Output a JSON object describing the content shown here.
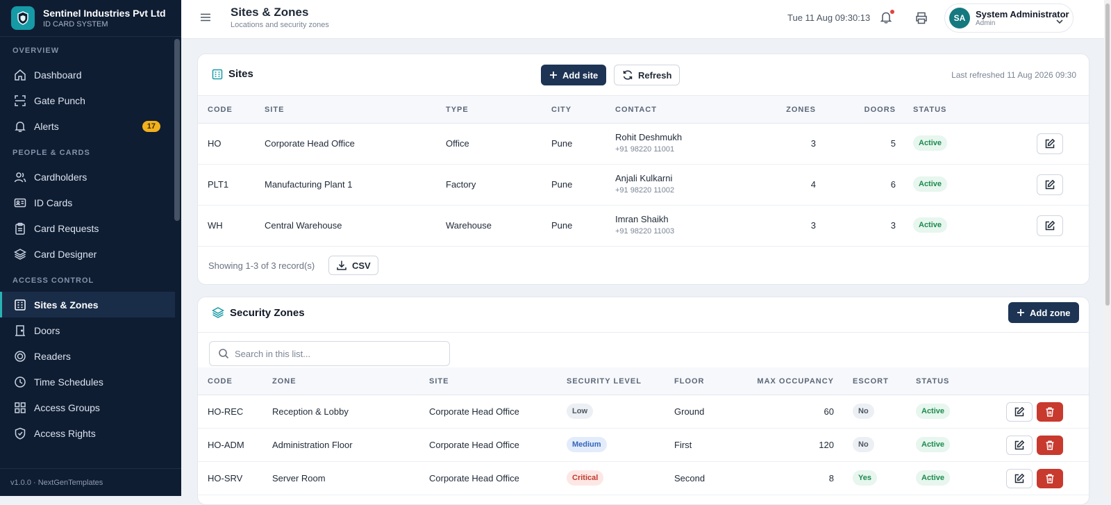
{
  "brand": {
    "name": "Sentinel Industries Pvt Ltd",
    "subtitle": "ID CARD SYSTEM"
  },
  "sidebar": {
    "sections": [
      "OVERVIEW",
      "PEOPLE & CARDS",
      "ACCESS CONTROL"
    ],
    "items": [
      {
        "label": "Dashboard",
        "icon": "home-icon"
      },
      {
        "label": "Gate Punch",
        "icon": "scan-icon"
      },
      {
        "label": "Alerts",
        "icon": "bell-icon",
        "badge": "17"
      },
      {
        "label": "Cardholders",
        "icon": "users-icon"
      },
      {
        "label": "ID Cards",
        "icon": "id-card-icon"
      },
      {
        "label": "Card Requests",
        "icon": "clipboard-icon"
      },
      {
        "label": "Card Designer",
        "icon": "layers-icon"
      },
      {
        "label": "Sites & Zones",
        "icon": "building-icon",
        "active": true
      },
      {
        "label": "Doors",
        "icon": "door-icon"
      },
      {
        "label": "Readers",
        "icon": "reader-icon"
      },
      {
        "label": "Time Schedules",
        "icon": "clock-icon"
      },
      {
        "label": "Access Groups",
        "icon": "grid-icon"
      },
      {
        "label": "Access Rights",
        "icon": "shield-icon"
      }
    ],
    "footer": "v1.0.0 · NextGenTemplates"
  },
  "header": {
    "title": "Sites & Zones",
    "subtitle": "Locations and security zones",
    "datetime": "Tue 11 Aug 09:30:13",
    "user": {
      "initials": "SA",
      "name": "System Administrator",
      "role": "Admin"
    }
  },
  "sites": {
    "title": "Sites",
    "add_label": "Add site",
    "refresh_label": "Refresh",
    "last_refreshed": "Last refreshed 11 Aug 2026 09:30",
    "columns": [
      "CODE",
      "SITE",
      "TYPE",
      "CITY",
      "CONTACT",
      "ZONES",
      "DOORS",
      "STATUS"
    ],
    "rows": [
      {
        "code": "HO",
        "site": "Corporate Head Office",
        "type": "Office",
        "city": "Pune",
        "contact": "Rohit Deshmukh",
        "phone": "+91 98220 11001",
        "zones": "3",
        "doors": "5",
        "status": "Active"
      },
      {
        "code": "PLT1",
        "site": "Manufacturing Plant 1",
        "type": "Factory",
        "city": "Pune",
        "contact": "Anjali Kulkarni",
        "phone": "+91 98220 11002",
        "zones": "4",
        "doors": "6",
        "status": "Active"
      },
      {
        "code": "WH",
        "site": "Central Warehouse",
        "type": "Warehouse",
        "city": "Pune",
        "contact": "Imran Shaikh",
        "phone": "+91 98220 11003",
        "zones": "3",
        "doors": "3",
        "status": "Active"
      }
    ],
    "showing": "Showing 1-3 of 3 record(s)",
    "csv_label": "CSV"
  },
  "zones": {
    "title": "Security Zones",
    "add_label": "Add zone",
    "search_placeholder": "Search in this list...",
    "columns": [
      "CODE",
      "ZONE",
      "SITE",
      "SECURITY LEVEL",
      "FLOOR",
      "MAX OCCUPANCY",
      "ESCORT",
      "STATUS"
    ],
    "rows": [
      {
        "code": "HO-REC",
        "zone": "Reception & Lobby",
        "site": "Corporate Head Office",
        "level": "Low",
        "floor": "Ground",
        "max": "60",
        "escort": "No",
        "status": "Active"
      },
      {
        "code": "HO-ADM",
        "zone": "Administration Floor",
        "site": "Corporate Head Office",
        "level": "Medium",
        "floor": "First",
        "max": "120",
        "escort": "No",
        "status": "Active"
      },
      {
        "code": "HO-SRV",
        "zone": "Server Room",
        "site": "Corporate Head Office",
        "level": "Critical",
        "floor": "Second",
        "max": "8",
        "escort": "Yes",
        "status": "Active"
      }
    ]
  },
  "colors": {
    "sidebar_bg": "#0f1d33",
    "primary": "#1d3454",
    "accent": "#169aa6",
    "danger": "#c8392e",
    "success": "#1c8a4d"
  }
}
